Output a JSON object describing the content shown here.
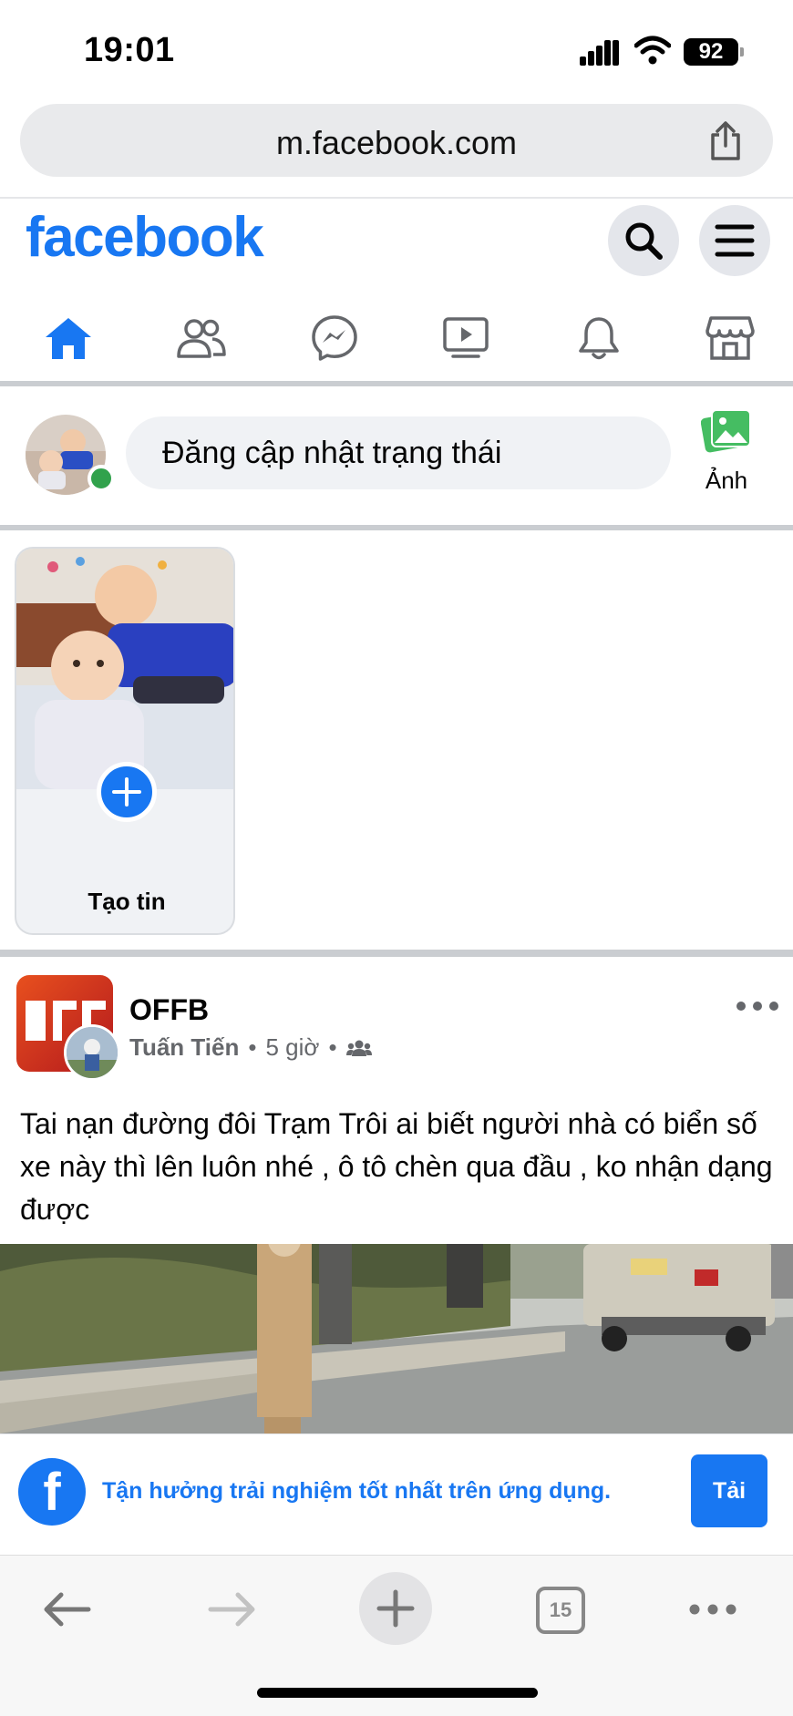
{
  "status_bar": {
    "time": "19:01",
    "battery": "92"
  },
  "browser": {
    "url": "m.facebook.com",
    "tabs_count": "15"
  },
  "header": {
    "logo": "facebook"
  },
  "nav": {
    "items": [
      {
        "icon": "home-icon",
        "active": true
      },
      {
        "icon": "friends-icon",
        "active": false
      },
      {
        "icon": "messenger-icon",
        "active": false
      },
      {
        "icon": "watch-icon",
        "active": false
      },
      {
        "icon": "bell-icon",
        "active": false
      },
      {
        "icon": "marketplace-icon",
        "active": false
      }
    ]
  },
  "composer": {
    "placeholder": "Đăng cập nhật trạng thái",
    "photo_label": "Ảnh"
  },
  "stories": {
    "create_label": "Tạo tin"
  },
  "post": {
    "group_name": "OFFB",
    "author": "Tuấn Tiến",
    "time": "5 giờ",
    "separator": "•",
    "text": "Tai nạn đường đôi Trạm Trôi ai biết người nhà có biển số xe này thì lên luôn nhé , ô tô chèn qua đầu , ko nhận dạng được"
  },
  "app_banner": {
    "text": "Tận hưởng trải nghiệm tốt nhất trên ứng dụng.",
    "button": "Tải",
    "logo_letter": "f"
  },
  "colors": {
    "brand": "#1877f2",
    "online": "#31a24c",
    "photo_green": "#45bd62"
  }
}
